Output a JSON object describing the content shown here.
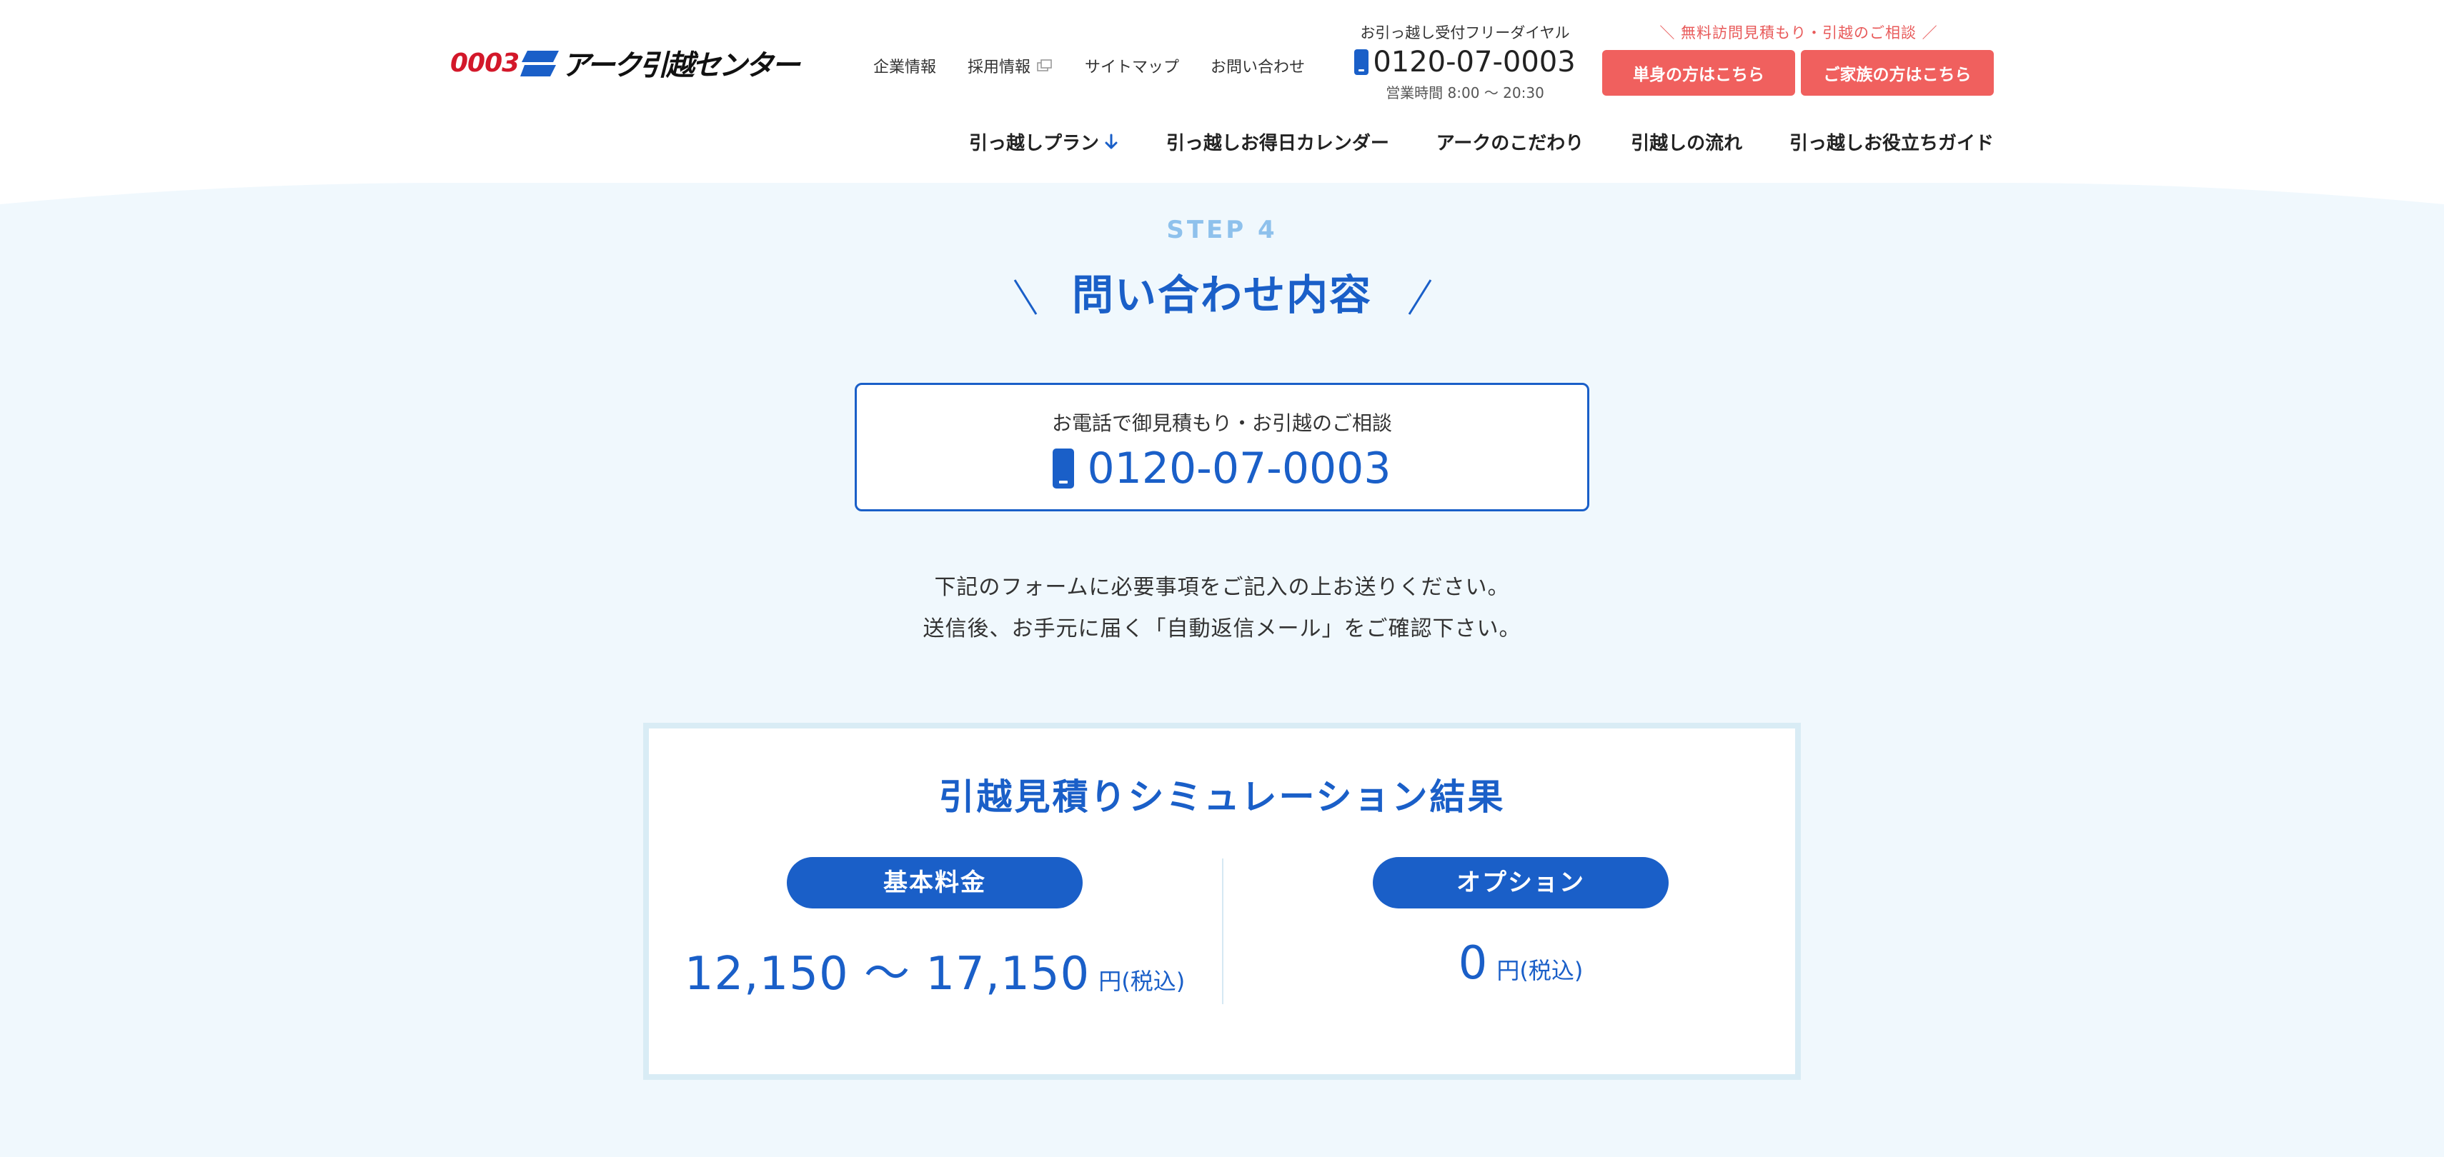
{
  "header": {
    "logo": {
      "number": "0003",
      "name": "アーク引越センター"
    },
    "util_nav": [
      {
        "label": "企業情報"
      },
      {
        "label": "採用情報",
        "icon": "external-link-icon"
      },
      {
        "label": "サイトマップ"
      },
      {
        "label": "お問い合わせ"
      }
    ],
    "tel": {
      "label": "お引っ越し受付フリーダイヤル",
      "number": "0120-07-0003",
      "hours": "営業時間 8:00 〜 20:30"
    },
    "cta": {
      "note": "＼ 無料訪問見積もり・引越のご相談 ／",
      "single_label": "単身の方はこちら",
      "family_label": "ご家族の方はこちら"
    },
    "main_nav": [
      {
        "label": "引っ越しプラン",
        "icon": "arrow-down-icon"
      },
      {
        "label": "引っ越しお得日カレンダー"
      },
      {
        "label": "アークのこだわり"
      },
      {
        "label": "引越しの流れ"
      },
      {
        "label": "引っ越しお役立ちガイド"
      }
    ]
  },
  "step": {
    "label": "STEP 4",
    "title": "問い合わせ内容"
  },
  "tel_box": {
    "label": "お電話で御見積もり・お引越のご相談",
    "number": "0120-07-0003"
  },
  "instructions": {
    "line1": "下記のフォームに必要事項をご記入の上お送りください。",
    "line2": "送信後、お手元に届く「自動返信メール」をご確認下さい。"
  },
  "result": {
    "title": "引越見積りシミュレーション結果",
    "basic": {
      "label": "基本料金",
      "value": "12,150 ～ 17,150",
      "unit": "円(税込)"
    },
    "option": {
      "label": "オプション",
      "value": "0",
      "unit": "円(税込)"
    }
  },
  "colors": {
    "primary_blue": "#1a5fc8",
    "accent_red": "#f0605e",
    "background": "#f0f8fd",
    "step_label": "#8ec1ec"
  }
}
